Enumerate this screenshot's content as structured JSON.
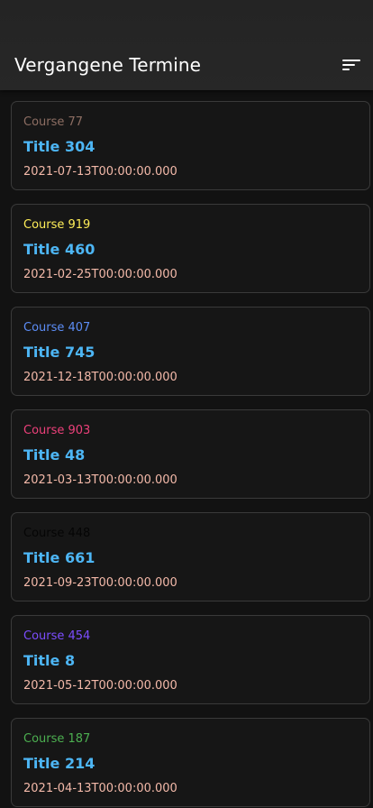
{
  "appbar": {
    "title": "Vergangene Termine",
    "filter_icon": "sort-icon"
  },
  "colors": {
    "title": "#4db6f5",
    "date": "#f3b9a9",
    "card_border": "#3a3a3a"
  },
  "items": [
    {
      "course": "Course 77",
      "course_color": "#8d6e63",
      "title": "Title 304",
      "date": "2021-07-13T00:00:00.000"
    },
    {
      "course": "Course 919",
      "course_color": "#ffee58",
      "title": "Title 460",
      "date": "2021-02-25T00:00:00.000"
    },
    {
      "course": "Course 407",
      "course_color": "#5c8df6",
      "title": "Title 745",
      "date": "2021-12-18T00:00:00.000"
    },
    {
      "course": "Course 903",
      "course_color": "#ec407a",
      "title": "Title 48",
      "date": "2021-03-13T00:00:00.000"
    },
    {
      "course": "Course 448",
      "course_color": "#050505",
      "title": "Title 661",
      "date": "2021-09-23T00:00:00.000"
    },
    {
      "course": "Course 454",
      "course_color": "#7c4dff",
      "title": "Title 8",
      "date": "2021-05-12T00:00:00.000"
    },
    {
      "course": "Course 187",
      "course_color": "#4caf50",
      "title": "Title 214",
      "date": "2021-04-13T00:00:00.000"
    }
  ]
}
